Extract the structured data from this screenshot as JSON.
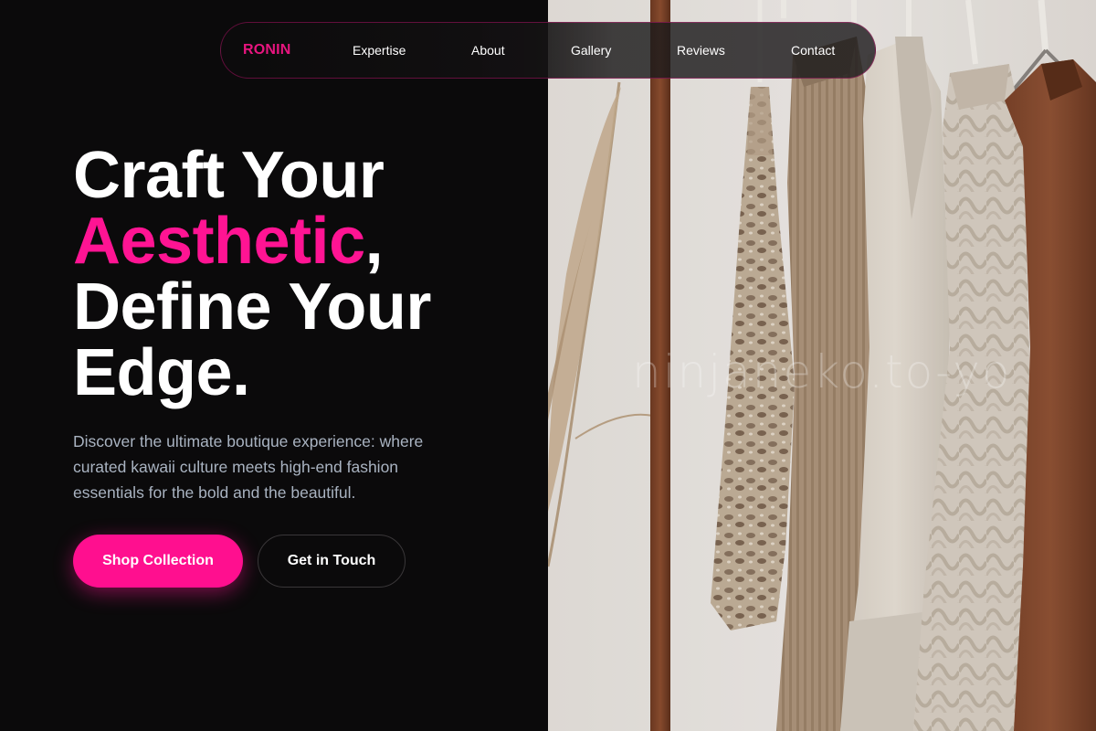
{
  "nav": {
    "logo": "RONIN",
    "links": [
      "Expertise",
      "About",
      "Gallery",
      "Reviews",
      "Contact"
    ]
  },
  "hero": {
    "title_line1": "Craft Your",
    "title_accent": "Aesthetic",
    "title_comma": ",",
    "title_line3": "Define Your",
    "title_line4": "Edge.",
    "description": "Discover the ultimate boutique experience: where curated kawaii culture meets high-end fashion essentials for the bold and the beautiful.",
    "primary_button": "Shop Collection",
    "secondary_button": "Get in Touch"
  },
  "image": {
    "watermark": "ninjaneko.to-yo"
  },
  "colors": {
    "accent": "#ff1493",
    "background": "#0b0a0b",
    "text": "#ffffff",
    "muted_text": "#a9b3c1"
  }
}
